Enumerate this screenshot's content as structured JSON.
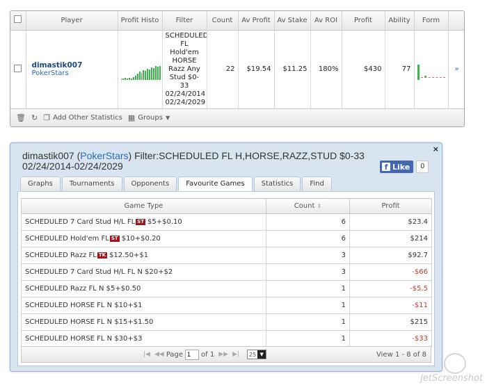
{
  "top_table": {
    "headers": [
      "Player",
      "Profit Histo",
      "Filter",
      "Count",
      "Av Profit",
      "Av Stake",
      "Av ROI",
      "Profit",
      "Ability",
      "Form"
    ],
    "row": {
      "player_name": "dimastik007",
      "player_site": "PokerStars",
      "filter_lines": [
        "SCHEDULED",
        "FL",
        "Hold'em",
        "HORSE",
        "Razz Any",
        "Stud $0-",
        "33",
        "02/24/2014",
        "02/24/2029"
      ],
      "count": "22",
      "av_profit": "$19.54",
      "av_stake": "$11.25",
      "av_roi": "180%",
      "profit": "$430",
      "ability": "77",
      "expand": "»"
    },
    "footer": {
      "add_stats": "Add Other Statistics",
      "groups": "Groups"
    }
  },
  "detail": {
    "title_player": "dimastik007",
    "title_site": "PokerStars",
    "title_rest": " Filter:SCHEDULED FL H,HORSE,RAZZ,STUD $0-33",
    "title_line2": "02/24/2014-02/24/2029",
    "close": "×",
    "fb_like_label": "Like",
    "fb_like_count": "0",
    "tabs": [
      "Graphs",
      "Tournaments",
      "Opponents",
      "Favourite Games",
      "Statistics",
      "Find"
    ],
    "active_tab": "Favourite Games",
    "table_headers": {
      "game_type": "Game Type",
      "count": "Count",
      "profit": "Profit"
    },
    "rows": [
      {
        "game": "SCHEDULED 7 Card Stud H/L FL",
        "badge": "ST",
        "stake": "$5+$0.10",
        "count": "6",
        "profit": "$23.4",
        "negative": false
      },
      {
        "game": "SCHEDULED Hold'em FL",
        "badge": "ST",
        "stake": "$10+$0.20",
        "count": "6",
        "profit": "$214",
        "negative": false
      },
      {
        "game": "SCHEDULED Razz FL",
        "badge": "TK",
        "stake": "$12.50+$1",
        "count": "3",
        "profit": "$92.7",
        "negative": false
      },
      {
        "game": "SCHEDULED 7 Card Stud H/L FL N",
        "badge": "",
        "stake": "$20+$2",
        "count": "3",
        "profit": "-$66",
        "negative": true
      },
      {
        "game": "SCHEDULED Razz FL N",
        "badge": "",
        "stake": "$5+$0.50",
        "count": "1",
        "profit": "-$5.5",
        "negative": true
      },
      {
        "game": "SCHEDULED HORSE FL N",
        "badge": "",
        "stake": "$10+$1",
        "count": "1",
        "profit": "-$11",
        "negative": true
      },
      {
        "game": "SCHEDULED HORSE FL N",
        "badge": "",
        "stake": "$15+$1.50",
        "count": "1",
        "profit": "$215",
        "negative": false
      },
      {
        "game": "SCHEDULED HORSE FL N",
        "badge": "",
        "stake": "$30+$3",
        "count": "1",
        "profit": "-$33",
        "negative": true
      }
    ],
    "pager": {
      "page_label": "Page",
      "page_value": "1",
      "of_label": "of 1",
      "per_page": "25",
      "view_text": "View 1 - 8 of 8"
    }
  },
  "watermark": "jetScreenshot",
  "colors": {
    "accent": "#2a6bb0",
    "negative": "#c0392b",
    "chart_green": "#39b54a",
    "badge": "#a8131b",
    "panel_bg": "#d8e5f1"
  }
}
